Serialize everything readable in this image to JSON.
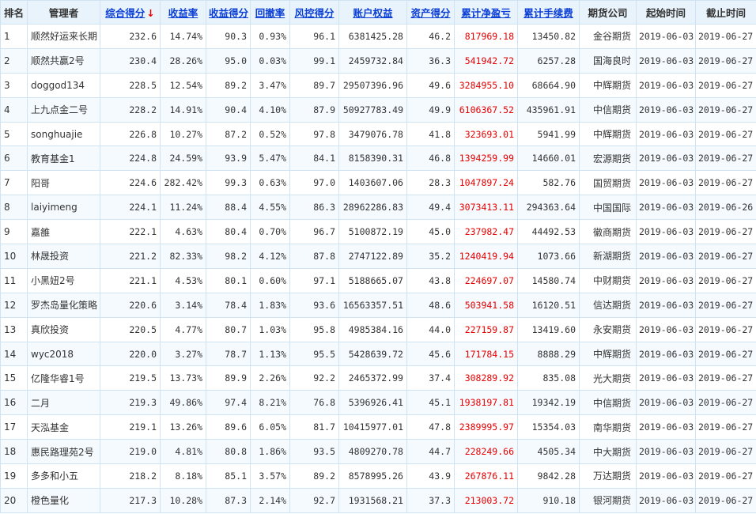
{
  "colors": {
    "header_bg": "#e8f3fb",
    "link": "#0b3fd6",
    "profit_red": "#e60000",
    "border": "#cfe3f2"
  },
  "header": {
    "rank": "排名",
    "manager": "管理者",
    "total_score": "综合得分",
    "sort_arrow": "↓",
    "return_rate": "收益率",
    "return_score": "收益得分",
    "drawdown": "回撤率",
    "risk_score": "风控得分",
    "equity": "账户权益",
    "asset_score": "资产得分",
    "net_pnl": "累计净盈亏",
    "fees": "累计手续费",
    "company": "期货公司",
    "start": "起始时间",
    "end": "截止时间"
  },
  "rows": [
    {
      "rank": "1",
      "manager": "顺然好运来长期",
      "total_score": "232.6",
      "return_rate": "14.74%",
      "return_score": "90.3",
      "drawdown": "0.93%",
      "risk_score": "96.1",
      "equity": "6381425.28",
      "asset_score": "46.2",
      "net_pnl": "817969.18",
      "fees": "13450.82",
      "company": "金谷期货",
      "start": "2019-06-03",
      "end": "2019-06-27"
    },
    {
      "rank": "2",
      "manager": "顺然共赢2号",
      "total_score": "230.4",
      "return_rate": "28.26%",
      "return_score": "95.0",
      "drawdown": "0.03%",
      "risk_score": "99.1",
      "equity": "2459732.84",
      "asset_score": "36.3",
      "net_pnl": "541942.72",
      "fees": "6257.28",
      "company": "国海良时",
      "start": "2019-06-03",
      "end": "2019-06-27"
    },
    {
      "rank": "3",
      "manager": "doggod134",
      "total_score": "228.5",
      "return_rate": "12.54%",
      "return_score": "89.2",
      "drawdown": "3.47%",
      "risk_score": "89.7",
      "equity": "29507396.96",
      "asset_score": "49.6",
      "net_pnl": "3284955.10",
      "fees": "68664.90",
      "company": "中辉期货",
      "start": "2019-06-03",
      "end": "2019-06-27"
    },
    {
      "rank": "4",
      "manager": "上九点金二号",
      "total_score": "228.2",
      "return_rate": "14.91%",
      "return_score": "90.4",
      "drawdown": "4.10%",
      "risk_score": "87.9",
      "equity": "50927783.49",
      "asset_score": "49.9",
      "net_pnl": "6106367.52",
      "fees": "435961.91",
      "company": "中信期货",
      "start": "2019-06-03",
      "end": "2019-06-27"
    },
    {
      "rank": "5",
      "manager": "songhuajie",
      "total_score": "226.8",
      "return_rate": "10.27%",
      "return_score": "87.2",
      "drawdown": "0.52%",
      "risk_score": "97.8",
      "equity": "3479076.78",
      "asset_score": "41.8",
      "net_pnl": "323693.01",
      "fees": "5941.99",
      "company": "中辉期货",
      "start": "2019-06-03",
      "end": "2019-06-27"
    },
    {
      "rank": "6",
      "manager": "教育基金1",
      "total_score": "224.8",
      "return_rate": "24.59%",
      "return_score": "93.9",
      "drawdown": "5.47%",
      "risk_score": "84.1",
      "equity": "8158390.31",
      "asset_score": "46.8",
      "net_pnl": "1394259.99",
      "fees": "14660.01",
      "company": "宏源期货",
      "start": "2019-06-03",
      "end": "2019-06-27"
    },
    {
      "rank": "7",
      "manager": "阳哥",
      "total_score": "224.6",
      "return_rate": "282.42%",
      "return_score": "99.3",
      "drawdown": "0.63%",
      "risk_score": "97.0",
      "equity": "1403607.06",
      "asset_score": "28.3",
      "net_pnl": "1047897.24",
      "fees": "582.76",
      "company": "国贸期货",
      "start": "2019-06-03",
      "end": "2019-06-27"
    },
    {
      "rank": "8",
      "manager": "laiyimeng",
      "total_score": "224.1",
      "return_rate": "11.24%",
      "return_score": "88.4",
      "drawdown": "4.55%",
      "risk_score": "86.3",
      "equity": "28962286.83",
      "asset_score": "49.4",
      "net_pnl": "3073413.11",
      "fees": "294363.64",
      "company": "中国国际",
      "start": "2019-06-03",
      "end": "2019-06-26"
    },
    {
      "rank": "9",
      "manager": "嘉雒",
      "total_score": "222.1",
      "return_rate": "4.63%",
      "return_score": "80.4",
      "drawdown": "0.70%",
      "risk_score": "96.7",
      "equity": "5100872.19",
      "asset_score": "45.0",
      "net_pnl": "237982.47",
      "fees": "44492.53",
      "company": "徽商期货",
      "start": "2019-06-03",
      "end": "2019-06-27"
    },
    {
      "rank": "10",
      "manager": "林晟投资",
      "total_score": "221.2",
      "return_rate": "82.33%",
      "return_score": "98.2",
      "drawdown": "4.12%",
      "risk_score": "87.8",
      "equity": "2747122.89",
      "asset_score": "35.2",
      "net_pnl": "1240419.94",
      "fees": "1073.66",
      "company": "新湖期货",
      "start": "2019-06-03",
      "end": "2019-06-27"
    },
    {
      "rank": "11",
      "manager": "小黑妞2号",
      "total_score": "221.1",
      "return_rate": "4.53%",
      "return_score": "80.1",
      "drawdown": "0.60%",
      "risk_score": "97.1",
      "equity": "5188665.07",
      "asset_score": "43.8",
      "net_pnl": "224697.07",
      "fees": "14580.74",
      "company": "中财期货",
      "start": "2019-06-03",
      "end": "2019-06-27"
    },
    {
      "rank": "12",
      "manager": "罗杰岛量化策略",
      "total_score": "220.6",
      "return_rate": "3.14%",
      "return_score": "78.4",
      "drawdown": "1.83%",
      "risk_score": "93.6",
      "equity": "16563357.51",
      "asset_score": "48.6",
      "net_pnl": "503941.58",
      "fees": "16120.51",
      "company": "信达期货",
      "start": "2019-06-03",
      "end": "2019-06-27"
    },
    {
      "rank": "13",
      "manager": "真欣投资",
      "total_score": "220.5",
      "return_rate": "4.77%",
      "return_score": "80.7",
      "drawdown": "1.03%",
      "risk_score": "95.8",
      "equity": "4985384.16",
      "asset_score": "44.0",
      "net_pnl": "227159.87",
      "fees": "13419.60",
      "company": "永安期货",
      "start": "2019-06-03",
      "end": "2019-06-27"
    },
    {
      "rank": "14",
      "manager": "wyc2018",
      "total_score": "220.0",
      "return_rate": "3.27%",
      "return_score": "78.7",
      "drawdown": "1.13%",
      "risk_score": "95.5",
      "equity": "5428639.72",
      "asset_score": "45.6",
      "net_pnl": "171784.15",
      "fees": "8888.29",
      "company": "中辉期货",
      "start": "2019-06-03",
      "end": "2019-06-27"
    },
    {
      "rank": "15",
      "manager": "亿隆华睿1号",
      "total_score": "219.5",
      "return_rate": "13.73%",
      "return_score": "89.9",
      "drawdown": "2.26%",
      "risk_score": "92.2",
      "equity": "2465372.99",
      "asset_score": "37.4",
      "net_pnl": "308289.92",
      "fees": "835.08",
      "company": "光大期货",
      "start": "2019-06-03",
      "end": "2019-06-27"
    },
    {
      "rank": "16",
      "manager": "二月",
      "total_score": "219.3",
      "return_rate": "49.86%",
      "return_score": "97.4",
      "drawdown": "8.21%",
      "risk_score": "76.8",
      "equity": "5396926.41",
      "asset_score": "45.1",
      "net_pnl": "1938197.81",
      "fees": "19342.19",
      "company": "中信期货",
      "start": "2019-06-03",
      "end": "2019-06-27"
    },
    {
      "rank": "17",
      "manager": "天泓基金",
      "total_score": "219.1",
      "return_rate": "13.26%",
      "return_score": "89.6",
      "drawdown": "6.05%",
      "risk_score": "81.7",
      "equity": "10415977.01",
      "asset_score": "47.8",
      "net_pnl": "2389995.97",
      "fees": "15354.03",
      "company": "南华期货",
      "start": "2019-06-03",
      "end": "2019-06-27"
    },
    {
      "rank": "18",
      "manager": "惠民路理苑2号",
      "total_score": "219.0",
      "return_rate": "4.81%",
      "return_score": "80.8",
      "drawdown": "1.86%",
      "risk_score": "93.5",
      "equity": "4809270.78",
      "asset_score": "44.7",
      "net_pnl": "228249.66",
      "fees": "4505.34",
      "company": "中大期货",
      "start": "2019-06-03",
      "end": "2019-06-27"
    },
    {
      "rank": "19",
      "manager": "多多和小五",
      "total_score": "218.2",
      "return_rate": "8.18%",
      "return_score": "85.1",
      "drawdown": "3.57%",
      "risk_score": "89.2",
      "equity": "8578995.26",
      "asset_score": "43.9",
      "net_pnl": "267876.11",
      "fees": "9842.28",
      "company": "万达期货",
      "start": "2019-06-03",
      "end": "2019-06-27"
    },
    {
      "rank": "20",
      "manager": "橙色量化",
      "total_score": "217.3",
      "return_rate": "10.28%",
      "return_score": "87.3",
      "drawdown": "2.14%",
      "risk_score": "92.7",
      "equity": "1931568.21",
      "asset_score": "37.3",
      "net_pnl": "213003.72",
      "fees": "910.18",
      "company": "银河期货",
      "start": "2019-06-03",
      "end": "2019-06-27"
    }
  ]
}
